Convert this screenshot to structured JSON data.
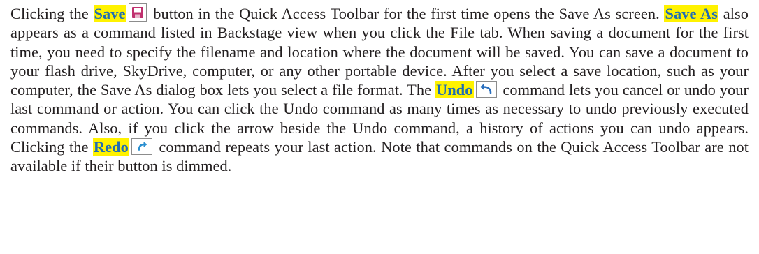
{
  "document": {
    "part1": "Clicking the ",
    "kw_save": "Save",
    "part2": " button in the Quick Access Toolbar for the first time opens the Save As screen. ",
    "kw_save_as": "Save As",
    "part3": " also appears as a command listed in Backstage view when you click the File tab. When saving a document for the first time, you need to specify the filename and location where the document will be saved. You can save a document to your flash drive, SkyDrive, computer, or any other portable device. After you select a save location, such as your computer, the Save As dialog box lets you select a file format. The ",
    "kw_undo": "Undo",
    "part4": " command lets you cancel or undo your last command or action. You can click the Undo command as many times as necessary to undo previously executed commands. Also, if you click the arrow beside the Undo command, a history of actions you can undo appears. Clicking the ",
    "kw_redo": "Redo",
    "part5": " command repeats your last action. Note that commands on the Quick Access Toolbar are not available if their button is dimmed."
  },
  "icons": {
    "save": "save-icon",
    "undo": "undo-icon",
    "redo": "redo-icon"
  },
  "colors": {
    "highlight": "#fff200",
    "keyword_text": "#1f6cb5",
    "body_text": "#231f20",
    "save_icon": "#c0306e",
    "undo_icon": "#2a6fbe",
    "redo_icon": "#2a8fd0"
  }
}
